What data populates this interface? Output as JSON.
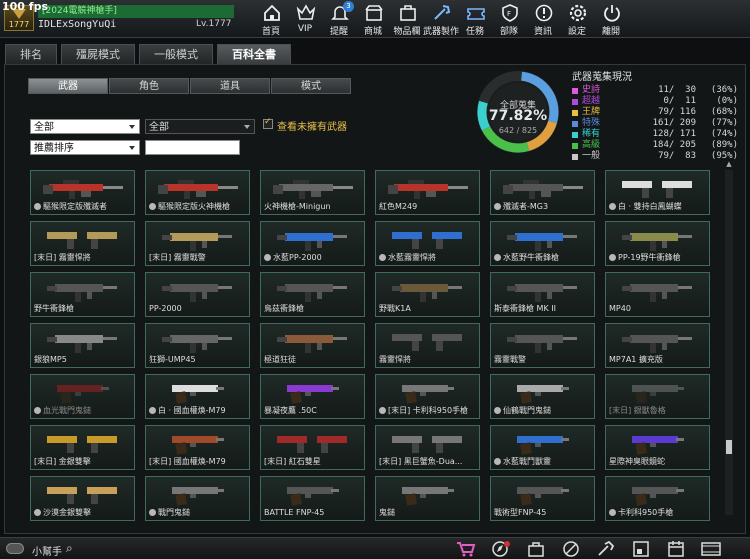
{
  "fps": "100 fps",
  "profile": {
    "rank": "1777",
    "title": "[2024電競神槍手]",
    "name": "IDLExSongYuQi",
    "level": "Lv.1777"
  },
  "nav": [
    {
      "label": "首頁",
      "icon": "home-icon"
    },
    {
      "label": "VIP",
      "icon": "crown-icon"
    },
    {
      "label": "提醒",
      "icon": "bell-icon",
      "badge": "3"
    },
    {
      "label": "商城",
      "icon": "shop-icon"
    },
    {
      "label": "物品欄",
      "icon": "bag-icon"
    },
    {
      "label": "武器製作",
      "icon": "craft-icon"
    },
    {
      "label": "任務",
      "icon": "ticket-icon"
    },
    {
      "label": "部隊",
      "icon": "shield-icon"
    },
    {
      "label": "資訊",
      "icon": "info-icon"
    },
    {
      "label": "設定",
      "icon": "gear-icon"
    },
    {
      "label": "離開",
      "icon": "power-icon"
    }
  ],
  "main_tabs": [
    "排名",
    "殭屍模式",
    "一般模式",
    "百科全書"
  ],
  "sub_tabs": [
    "武器",
    "角色",
    "道具",
    "模式"
  ],
  "filters": {
    "filter1": "全部",
    "filter2": "全部",
    "sort": "推薦排序",
    "search": "",
    "show_unowned": "查看未擁有武器"
  },
  "collection": {
    "label": "全部蒐集",
    "percent": "77.82%",
    "count": "642 / 825",
    "progress": 0.7782
  },
  "stats": {
    "title": "武器蒐集現況",
    "rows": [
      {
        "name": "史詩",
        "count": "11/  30",
        "pct": "(36%)",
        "color": "#e05ae0"
      },
      {
        "name": "超越",
        "count": " 0/  11",
        "pct": " (0%)",
        "color": "#b04ad8"
      },
      {
        "name": "王牌",
        "count": "79/ 116",
        "pct": "(68%)",
        "color": "#e8c03a"
      },
      {
        "name": "特殊",
        "count": "161/ 209",
        "pct": "(77%)",
        "color": "#5a8ad8"
      },
      {
        "name": "稀有",
        "count": "128/ 171",
        "pct": "(74%)",
        "color": "#3ad0d0"
      },
      {
        "name": "高級",
        "count": "184/ 205",
        "pct": "(89%)",
        "color": "#4ac04a"
      },
      {
        "name": "一般",
        "count": "79/  83",
        "pct": "(95%)",
        "color": "#c8c8c8"
      }
    ]
  },
  "weapons": [
    {
      "name": "驅猴限定版殲滅者",
      "crest": true,
      "shape": "mg",
      "color": "#b8332a"
    },
    {
      "name": "驅猴限定版火神機槍",
      "crest": true,
      "shape": "mg",
      "color": "#b8332a"
    },
    {
      "name": "火神機槍-Minigun",
      "shape": "mg",
      "color": "#666"
    },
    {
      "name": "紅色M249",
      "shape": "mg",
      "color": "#b8332a"
    },
    {
      "name": "殲滅者-MG3",
      "crest": true,
      "shape": "mg",
      "color": "#555"
    },
    {
      "name": "白 · 雙持白鳳蝴蝶",
      "crest": true,
      "shape": "dual",
      "color": "#ddd"
    },
    {
      "name": "[末日] 霧靈悍將",
      "shape": "dual",
      "color": "#b49a5a"
    },
    {
      "name": "[末日] 霧靈戰警",
      "shape": "smg",
      "color": "#b49a5a"
    },
    {
      "name": "水藍PP-2000",
      "crest": true,
      "shape": "smg",
      "color": "#2f6fd0"
    },
    {
      "name": "水藍霧靈悍將",
      "crest": true,
      "shape": "dual",
      "color": "#2f6fd0"
    },
    {
      "name": "水藍野牛衝鋒槍",
      "crest": true,
      "shape": "smg",
      "color": "#2f6fd0"
    },
    {
      "name": "PP-19野牛衝鋒槍",
      "crest": true,
      "shape": "smg",
      "color": "#8a8a4a"
    },
    {
      "name": "野牛衝鋒槍",
      "shape": "smg",
      "color": "#555"
    },
    {
      "name": "PP-2000",
      "shape": "smg",
      "color": "#555"
    },
    {
      "name": "鳥茲衝鋒槍",
      "shape": "smg",
      "color": "#555"
    },
    {
      "name": "野戰K1A",
      "shape": "smg",
      "color": "#6a5a3a"
    },
    {
      "name": "斯泰衝鋒槍 MK II",
      "shape": "smg",
      "color": "#555"
    },
    {
      "name": "MP40",
      "shape": "smg",
      "color": "#555"
    },
    {
      "name": "銀狼MP5",
      "shape": "smg",
      "color": "#888"
    },
    {
      "name": "狂獅-UMP45",
      "shape": "smg",
      "color": "#666"
    },
    {
      "name": "極道狂徒",
      "shape": "smg",
      "color": "#8a5a3a"
    },
    {
      "name": "霧靈悍將",
      "shape": "dual",
      "color": "#555"
    },
    {
      "name": "霧靈戰警",
      "shape": "smg",
      "color": "#555"
    },
    {
      "name": "MP7A1 擴充版",
      "shape": "smg",
      "color": "#555"
    },
    {
      "name": "血光戰門鬼鎚",
      "crest": true,
      "dim": true,
      "shape": "pistol",
      "color": "#a02020"
    },
    {
      "name": "白 · 國血權煥-M79",
      "crest": true,
      "shape": "pistol",
      "color": "#ddd"
    },
    {
      "name": "暴凝夜鷹 .50C",
      "shape": "pistol",
      "color": "#8a3ad0"
    },
    {
      "name": "[末日] 卡利科950手槍",
      "crest": true,
      "shape": "pistol",
      "color": "#777"
    },
    {
      "name": "仙鶴戰門鬼鎚",
      "crest": true,
      "shape": "pistol",
      "color": "#aaa"
    },
    {
      "name": "[末日] 銀獸魯格",
      "dim": true,
      "shape": "pistol",
      "color": "#777"
    },
    {
      "name": "[末日] 金銀雙擊",
      "shape": "dual",
      "color": "#c89a2a"
    },
    {
      "name": "[末日] 國血權煥-M79",
      "shape": "pistol",
      "color": "#a04a2a"
    },
    {
      "name": "[末日] 紅石雙星",
      "shape": "dual",
      "color": "#a02a2a"
    },
    {
      "name": "[末日] 黑巨蟹魚-Dua...",
      "shape": "dual",
      "color": "#777"
    },
    {
      "name": "水藍戰鬥獸靈",
      "crest": true,
      "shape": "pistol",
      "color": "#2f6fd0"
    },
    {
      "name": "星際神臭眼鏡蛇",
      "shape": "pistol",
      "color": "#5a3ad0"
    },
    {
      "name": "沙漠金銀雙擊",
      "crest": true,
      "shape": "dual",
      "color": "#c8a05a"
    },
    {
      "name": "戰門鬼鎚",
      "crest": true,
      "shape": "pistol",
      "color": "#777"
    },
    {
      "name": "BATTLE FNP-45",
      "shape": "pistol",
      "color": "#555"
    },
    {
      "name": "鬼鎚",
      "shape": "pistol",
      "color": "#777"
    },
    {
      "name": "戰術型FNP-45",
      "shape": "pistol",
      "color": "#555"
    },
    {
      "name": "卡利科950手槍",
      "crest": true,
      "shape": "pistol",
      "color": "#555"
    }
  ],
  "bottom": {
    "helper": "小幫手"
  }
}
